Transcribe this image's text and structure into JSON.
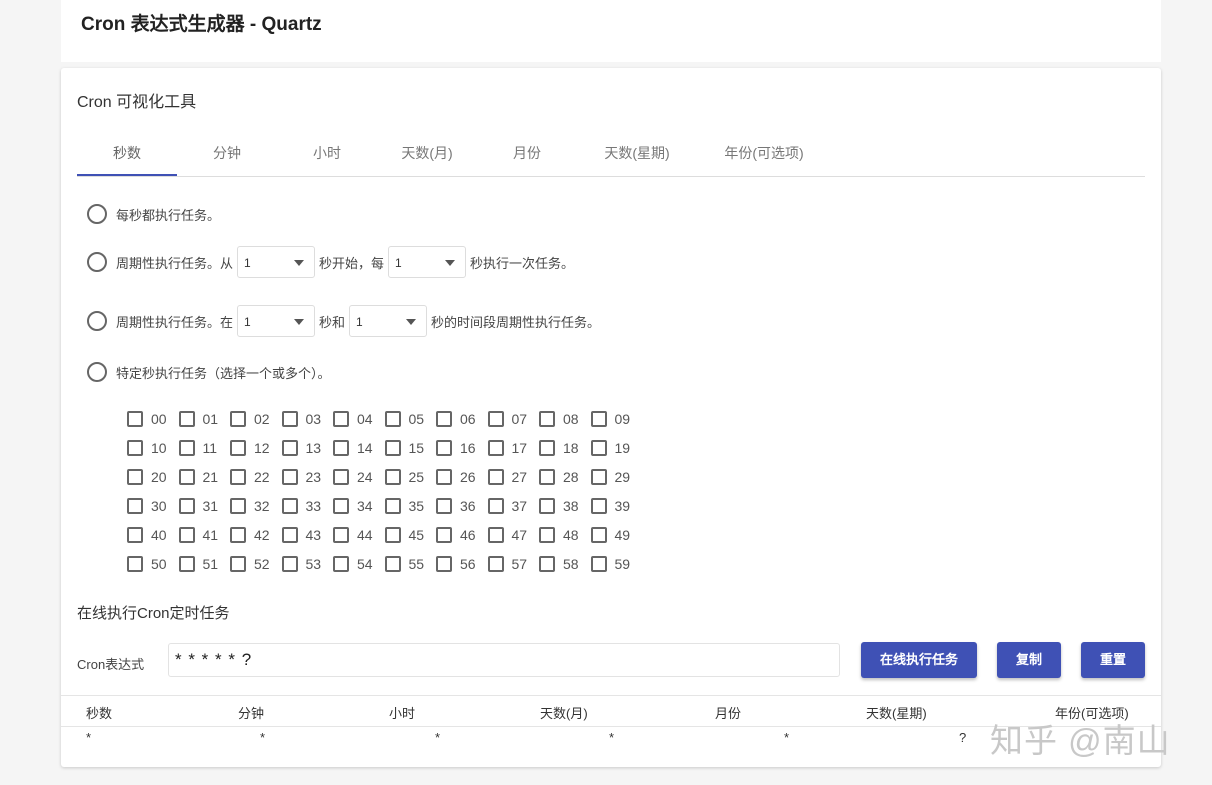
{
  "app": {
    "title": "Cron 表达式生成器 - Quartz"
  },
  "card_title": "Cron 可视化工具",
  "tabs": [
    {
      "label": "秒数",
      "active": true
    },
    {
      "label": "分钟"
    },
    {
      "label": "小时"
    },
    {
      "label": "天数(月)"
    },
    {
      "label": "月份"
    },
    {
      "label": "天数(星期)"
    },
    {
      "label": "年份(可选项)"
    }
  ],
  "options": {
    "every": "每秒都执行任务。",
    "cycle_prefix": "周期性执行任务。从",
    "cycle_start_value": "1",
    "cycle_mid": "秒开始，每",
    "cycle_interval_value": "1",
    "cycle_suffix": "秒执行一次任务。",
    "range_prefix": "周期性执行任务。在",
    "range_from_value": "1",
    "range_mid": "秒和",
    "range_to_value": "1",
    "range_suffix": "秒的时间段周期性执行任务。",
    "specific": "特定秒执行任务（选择一个或多个）。"
  },
  "seconds_rows": [
    [
      "00",
      "01",
      "02",
      "03",
      "04",
      "05",
      "06",
      "07",
      "08",
      "09"
    ],
    [
      "10",
      "11",
      "12",
      "13",
      "14",
      "15",
      "16",
      "17",
      "18",
      "19"
    ],
    [
      "20",
      "21",
      "22",
      "23",
      "24",
      "25",
      "26",
      "27",
      "28",
      "29"
    ],
    [
      "30",
      "31",
      "32",
      "33",
      "34",
      "35",
      "36",
      "37",
      "38",
      "39"
    ],
    [
      "40",
      "41",
      "42",
      "43",
      "44",
      "45",
      "46",
      "47",
      "48",
      "49"
    ],
    [
      "50",
      "51",
      "52",
      "53",
      "54",
      "55",
      "56",
      "57",
      "58",
      "59"
    ]
  ],
  "online": {
    "title": "在线执行Cron定时任务",
    "expr_label": "Cron表达式",
    "expr_value": "* * * * * ?",
    "run_button": "在线执行任务",
    "copy_button": "复制",
    "reset_button": "重置"
  },
  "table": {
    "headers": [
      "秒数",
      "分钟",
      "小时",
      "天数(月)",
      "月份",
      "天数(星期)",
      "年份(可选项)"
    ],
    "values": [
      "*",
      "*",
      "*",
      "*",
      "*",
      "?",
      ""
    ]
  },
  "watermark": "知乎 @南山"
}
